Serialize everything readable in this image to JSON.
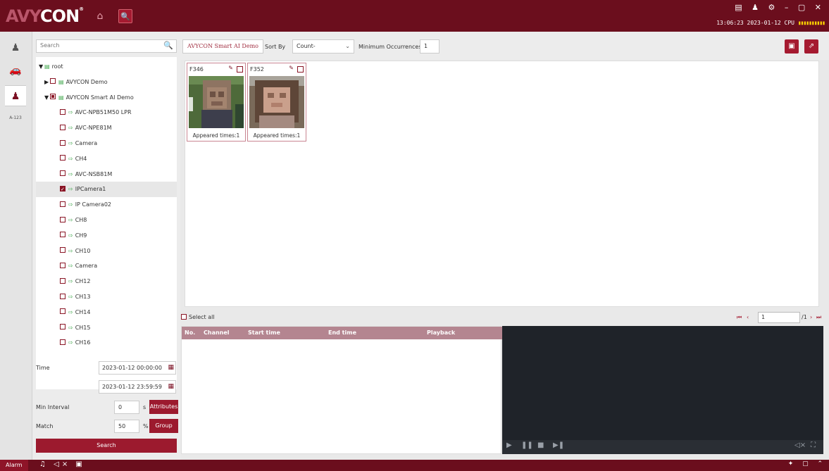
{
  "app": {
    "logo_prefix": "AVY",
    "logo_main": "CON",
    "logo_mark": "®",
    "clock": "13:06:23 2023-01-12",
    "cpu_label": "CPU",
    "cpu_meter": "▮▮▮▮▮▮▮▮▮▮",
    "window_controls": "▤ ♟ ⚙ – ▢ ✕"
  },
  "icons": {
    "home": "⌂",
    "ai_search": "🔍",
    "strip_people": "♟",
    "strip_car": "🚗",
    "strip_face": "♟",
    "strip_lpr": "A-123"
  },
  "search": {
    "placeholder": "Search",
    "icon": "🔍"
  },
  "tree": [
    {
      "label": "root",
      "caret": "▼",
      "checkbox": "none",
      "node_icon": "▤",
      "indent": 0
    },
    {
      "label": "AVYCON Demo",
      "caret": "▶",
      "checkbox": "unchecked",
      "node_icon": "▤",
      "indent": 1
    },
    {
      "label": "AVYCON Smart AI Demo",
      "caret": "▼",
      "checkbox": "partial",
      "node_icon": "▤",
      "indent": 1
    },
    {
      "label": "AVC-NPB51M50 LPR",
      "caret": "",
      "checkbox": "unchecked",
      "node_icon": "⇨",
      "indent": 2
    },
    {
      "label": "AVC-NPE81M",
      "caret": "",
      "checkbox": "unchecked",
      "node_icon": "⇨",
      "indent": 2
    },
    {
      "label": "Camera",
      "caret": "",
      "checkbox": "unchecked",
      "node_icon": "⇨",
      "indent": 2
    },
    {
      "label": "CH4",
      "caret": "",
      "checkbox": "unchecked",
      "node_icon": "⇨",
      "indent": 2
    },
    {
      "label": "AVC-NSB81M",
      "caret": "",
      "checkbox": "unchecked",
      "node_icon": "⇨",
      "indent": 2
    },
    {
      "label": "IPCamera1",
      "caret": "",
      "checkbox": "checked",
      "node_icon": "⇨",
      "indent": 2,
      "selected": true
    },
    {
      "label": "IP Camera02",
      "caret": "",
      "checkbox": "unchecked",
      "node_icon": "⇨",
      "indent": 2
    },
    {
      "label": "CH8",
      "caret": "",
      "checkbox": "unchecked",
      "node_icon": "⇨",
      "indent": 2
    },
    {
      "label": "CH9",
      "caret": "",
      "checkbox": "unchecked",
      "node_icon": "⇨",
      "indent": 2
    },
    {
      "label": "CH10",
      "caret": "",
      "checkbox": "unchecked",
      "node_icon": "⇨",
      "indent": 2
    },
    {
      "label": "Camera",
      "caret": "",
      "checkbox": "unchecked",
      "node_icon": "⇨",
      "indent": 2
    },
    {
      "label": "CH12",
      "caret": "",
      "checkbox": "unchecked",
      "node_icon": "⇨",
      "indent": 2
    },
    {
      "label": "CH13",
      "caret": "",
      "checkbox": "unchecked",
      "node_icon": "⇨",
      "indent": 2
    },
    {
      "label": "CH14",
      "caret": "",
      "checkbox": "unchecked",
      "node_icon": "⇨",
      "indent": 2
    },
    {
      "label": "CH15",
      "caret": "",
      "checkbox": "unchecked",
      "node_icon": "⇨",
      "indent": 2
    },
    {
      "label": "CH16",
      "caret": "",
      "checkbox": "unchecked",
      "node_icon": "⇨",
      "indent": 2
    }
  ],
  "filters": {
    "time_label": "Time",
    "start_time": "2023-01-12 00:00:00",
    "end_time": "2023-01-12 23:59:59",
    "min_interval_label": "Min Interval",
    "min_interval_value": "0",
    "min_interval_unit": "s",
    "attributes_label": "Attributes",
    "match_label": "Match",
    "match_value": "50",
    "match_unit": "%",
    "group_label": "Group",
    "search_label": "Search",
    "calendar_icon": "▦"
  },
  "toolbar": {
    "tab_label": "AVYCON Smart AI Demo",
    "sort_by_label": "Sort By",
    "sort_by_value": "Count-",
    "chevron": "⌄",
    "min_occ_label": "Minimum Occurrences",
    "min_occ_value": "1",
    "save_icon": "▣",
    "export_icon": "⇗"
  },
  "results": [
    {
      "id": "F346",
      "appeared": "Appeared times:1"
    },
    {
      "id": "F352",
      "appeared": "Appeared times:1"
    }
  ],
  "list": {
    "select_all_label": "Select all",
    "columns": {
      "no": "No.",
      "channel": "Channel",
      "start": "Start time",
      "end": "End time",
      "playback": "Playback"
    },
    "pager": {
      "first": "⏮",
      "prev": "‹",
      "page": "1",
      "total": "/1",
      "next": "›",
      "last": "⏭"
    }
  },
  "player": {
    "play": "▶",
    "pause": "❚❚",
    "stop": "■",
    "step": "▶❚",
    "mute": "◁×",
    "fullscreen": "⛶"
  },
  "statusbar": {
    "alarm_label": "Alarm",
    "icons": "♫ ◁× ▣",
    "right_icons": "✦ ▢ ⌃"
  }
}
